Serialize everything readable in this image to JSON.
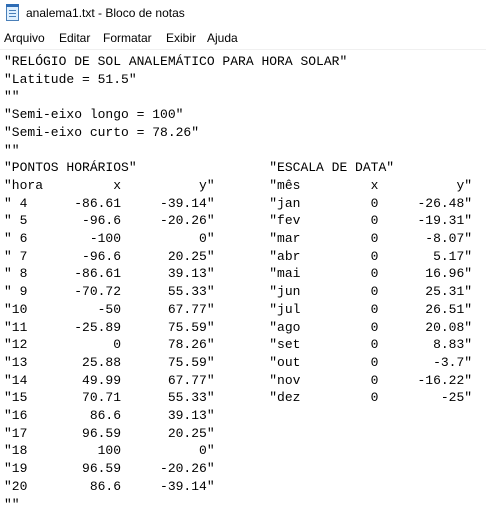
{
  "window": {
    "title": "analema1.txt - Bloco de notas"
  },
  "menubar": {
    "items": [
      {
        "label": "Arquivo"
      },
      {
        "label": "Editar"
      },
      {
        "label": "Formatar"
      },
      {
        "label": "Exibir"
      },
      {
        "label": "Ajuda"
      }
    ]
  },
  "editor": {
    "lines": [
      "\"RELÓGIO DE SOL ANALEMÁTICO PARA HORA SOLAR\"",
      "\"Latitude = 51.5\"",
      "\"\"",
      "\"Semi-eixo longo = 100\"",
      "\"Semi-eixo curto = 78.26\"",
      "\"\"",
      "\"PONTOS HORÁRIOS\"                 \"ESCALA DE DATA\"",
      "\"hora         x          y\"       \"mês         x          y\"",
      "\" 4      -86.61     -39.14\"       \"jan         0     -26.48\"",
      "\" 5       -96.6     -20.26\"       \"fev         0     -19.31\"",
      "\" 6        -100          0\"       \"mar         0      -8.07\"",
      "\" 7       -96.6      20.25\"       \"abr         0       5.17\"",
      "\" 8      -86.61      39.13\"       \"mai         0      16.96\"",
      "\" 9      -70.72      55.33\"       \"jun         0      25.31\"",
      "\"10         -50      67.77\"       \"jul         0      26.51\"",
      "\"11      -25.89      75.59\"       \"ago         0      20.08\"",
      "\"12           0      78.26\"       \"set         0       8.83\"",
      "\"13       25.88      75.59\"       \"out         0       -3.7\"",
      "\"14       49.99      67.77\"       \"nov         0     -16.22\"",
      "\"15       70.71      55.33\"       \"dez         0        -25\"",
      "\"16        86.6      39.13\"",
      "\"17       96.59      20.25\"",
      "\"18         100          0\"",
      "\"19       96.59     -20.26\"",
      "\"20        86.6     -39.14\"",
      "\"\""
    ]
  }
}
